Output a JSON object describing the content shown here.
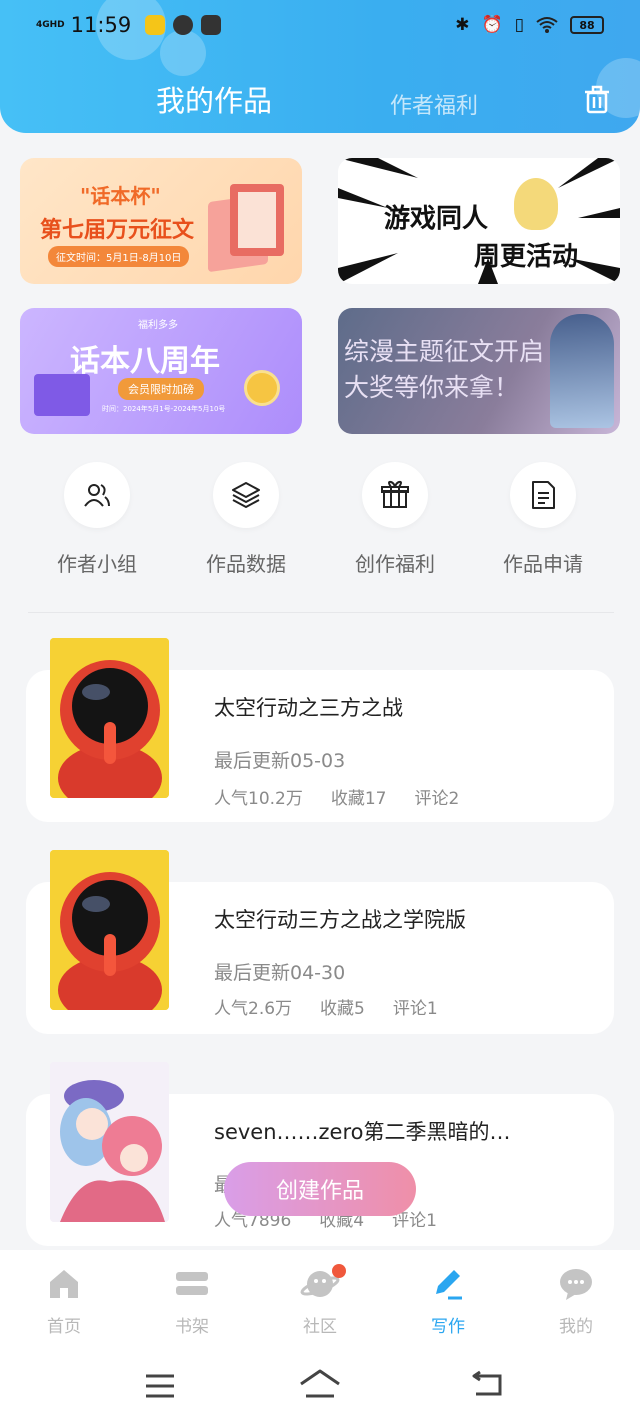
{
  "status_bar": {
    "network": "4GHD",
    "time": "11:59",
    "battery": "88"
  },
  "header": {
    "title": "我的作品",
    "secondary_tab": "作者福利"
  },
  "banners": [
    {
      "line1": "\"话本杯\"",
      "line2": "第七届万元征文",
      "line3": "征文时间：5月1日-8月10日"
    },
    {
      "line1": "游戏同人",
      "line2": "周更活动"
    },
    {
      "tag": "福利多多",
      "line1": "话本八周年",
      "line2": "会员限时加磅",
      "line3": "时间：2024年5月1号-2024年5月10号"
    },
    {
      "line1": "综漫主题征文开启",
      "line2": "大奖等你来拿！"
    }
  ],
  "quick_actions": [
    {
      "label": "作者小组",
      "icon": "users-icon"
    },
    {
      "label": "作品数据",
      "icon": "layers-icon"
    },
    {
      "label": "创作福利",
      "icon": "gift-icon"
    },
    {
      "label": "作品申请",
      "icon": "document-icon"
    }
  ],
  "works": [
    {
      "title": "太空行动之三方之战",
      "updated": "最后更新05-03",
      "popularity": "人气10.2万",
      "favorites": "收藏17",
      "comments": "评论2"
    },
    {
      "title": "太空行动三方之战之学院版",
      "updated": "最后更新04-30",
      "popularity": "人气2.6万",
      "favorites": "收藏5",
      "comments": "评论1"
    },
    {
      "title": "seven……zero第二季黑暗的…",
      "updated": "最",
      "popularity": "人气7896",
      "favorites": "收藏4",
      "comments": "评论1"
    }
  ],
  "create_button": "创建作品",
  "tabbar": [
    {
      "label": "首页"
    },
    {
      "label": "书架"
    },
    {
      "label": "社区"
    },
    {
      "label": "写作"
    },
    {
      "label": "我的"
    }
  ],
  "colors": {
    "accent": "#2aa6f0",
    "header": "#3fb4f3",
    "badge": "#f0583c"
  }
}
